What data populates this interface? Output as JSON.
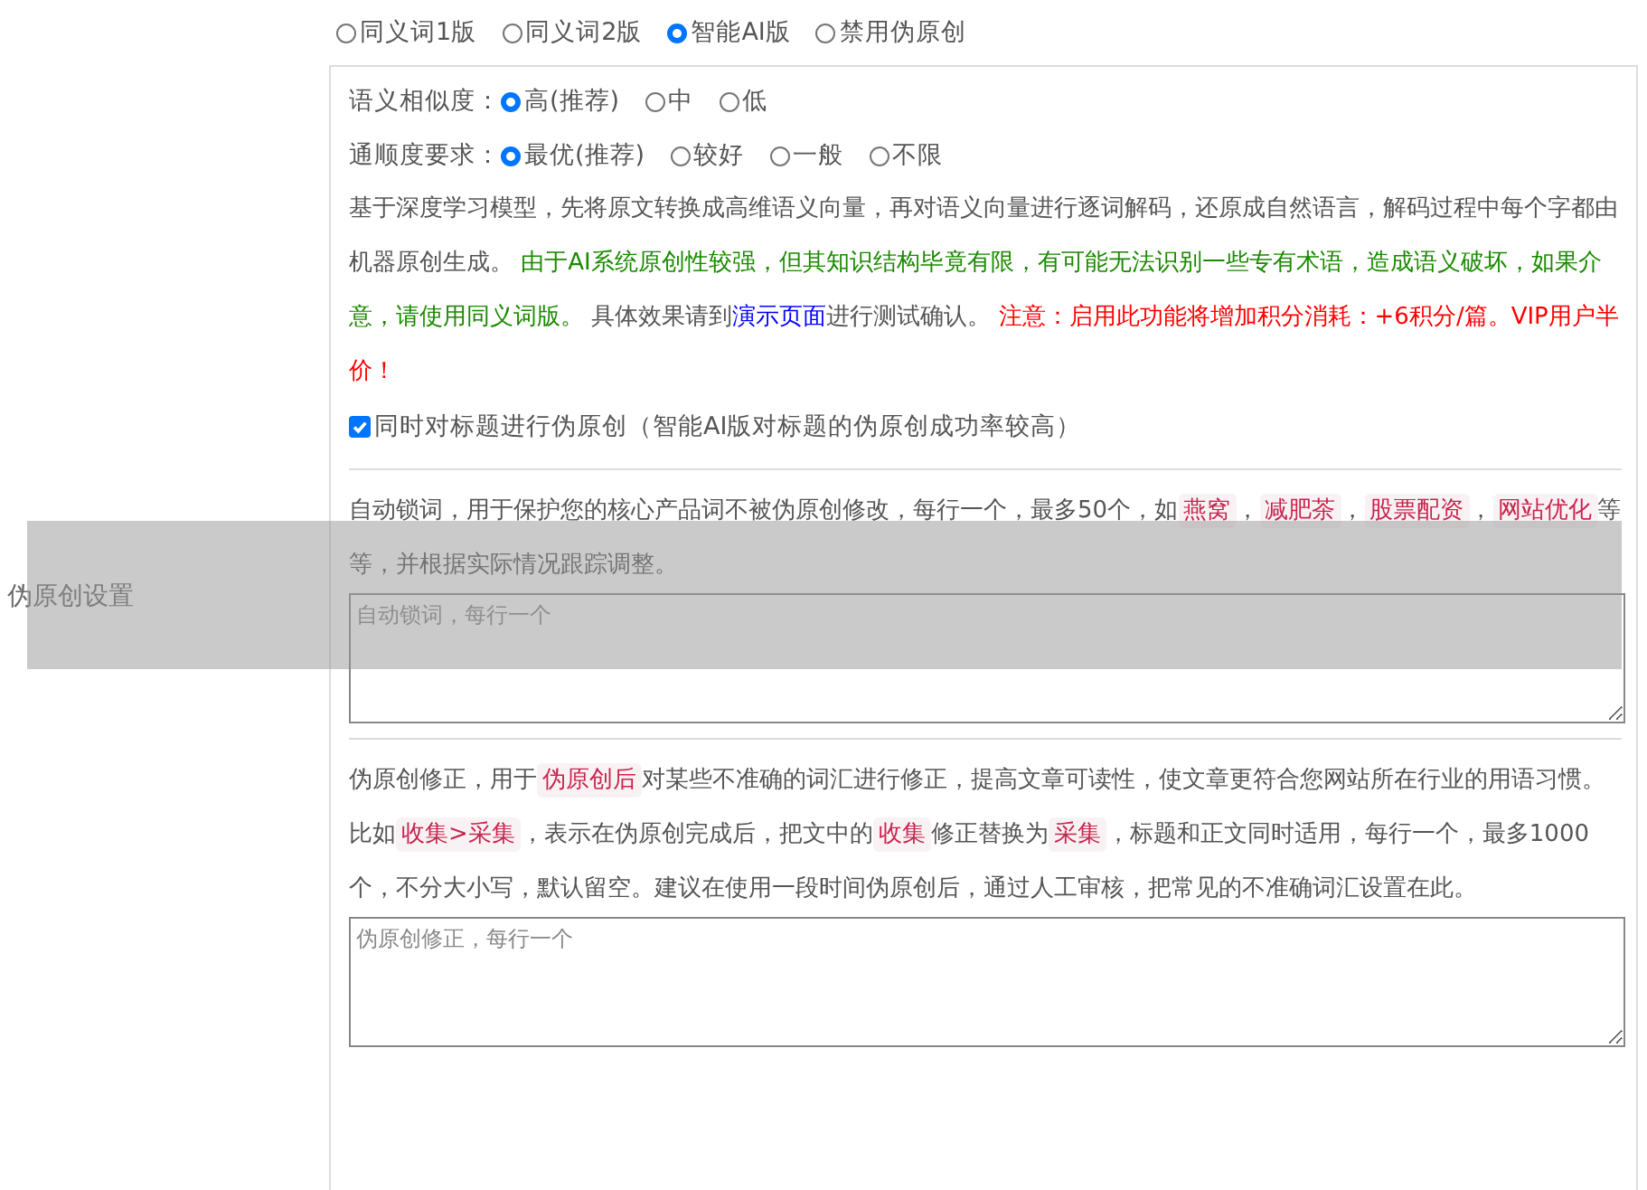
{
  "section_label": "伪原创设置",
  "modes": [
    {
      "label": "同义词1版",
      "selected": false
    },
    {
      "label": "同义词2版",
      "selected": false
    },
    {
      "label": "智能AI版",
      "selected": true
    },
    {
      "label": "禁用伪原创",
      "selected": false
    }
  ],
  "settings": [
    {
      "label": "语义相似度：",
      "options": [
        {
          "label": "高(推荐)",
          "selected": true
        },
        {
          "label": "中",
          "selected": false
        },
        {
          "label": "低",
          "selected": false
        }
      ]
    },
    {
      "label": "通顺度要求：",
      "options": [
        {
          "label": "最优(推荐)",
          "selected": true
        },
        {
          "label": "较好",
          "selected": false
        },
        {
          "label": "一般",
          "selected": false
        },
        {
          "label": "不限",
          "selected": false
        }
      ]
    }
  ],
  "description": [
    {
      "kind": "plain",
      "text": "基于深度学习模型，先将原文转换成高维语义向量，再对语义向量进行逐词解码，还原成自然语言，解码过程中每个字都由机器原创生成。 "
    },
    {
      "kind": "green",
      "text": "由于AI系统原创性较强，但其知识结构毕竟有限，有可能无法识别一些专有术语，造成语义破坏，如果介意，请使用同义词版。"
    },
    {
      "kind": "plain",
      "text": " 具体效果请到"
    },
    {
      "kind": "link",
      "text": "演示页面"
    },
    {
      "kind": "plain",
      "text": "进行测试确认。 "
    },
    {
      "kind": "red",
      "text": "注意：启用此功能将增加积分消耗：+6积分/篇。VIP用户半价！"
    }
  ],
  "title_option": {
    "label": "同时对标题进行伪原创（智能AI版对标题的伪原创成功率较高）",
    "checked": true
  },
  "lock_words": {
    "description": [
      {
        "kind": "plain",
        "text": "自动锁词，用于保护您的核心产品词不被伪原创修改，每行一个，最多50个，如"
      },
      {
        "kind": "code",
        "text": "燕窝"
      },
      {
        "kind": "plain",
        "text": "，"
      },
      {
        "kind": "code",
        "text": "减肥茶"
      },
      {
        "kind": "plain",
        "text": "，"
      },
      {
        "kind": "code",
        "text": "股票配资"
      },
      {
        "kind": "plain",
        "text": "，"
      },
      {
        "kind": "code",
        "text": "网站优化"
      },
      {
        "kind": "plain",
        "text": "等等，并根据实际情况跟踪调整。"
      }
    ],
    "placeholder": "自动锁词，每行一个"
  },
  "corrections": {
    "description": [
      {
        "kind": "plain",
        "text": "伪原创修正，用于"
      },
      {
        "kind": "code",
        "text": "伪原创后"
      },
      {
        "kind": "plain",
        "text": "对某些不准确的词汇进行修正，提高文章可读性，使文章更符合您网站所在行业的用语习惯。比如"
      },
      {
        "kind": "code",
        "text": "收集>采集"
      },
      {
        "kind": "plain",
        "text": "，表示在伪原创完成后，把文中的"
      },
      {
        "kind": "code",
        "text": "收集"
      },
      {
        "kind": "plain",
        "text": "修正替换为"
      },
      {
        "kind": "code",
        "text": "采集"
      },
      {
        "kind": "plain",
        "text": "，标题和正文同时适用，每行一个，最多1000个，不分大小写，默认留空。建议在使用一段时间伪原创后，通过人工审核，把常见的不准确词汇设置在此。"
      }
    ],
    "placeholder": "伪原创修正，每行一个"
  }
}
